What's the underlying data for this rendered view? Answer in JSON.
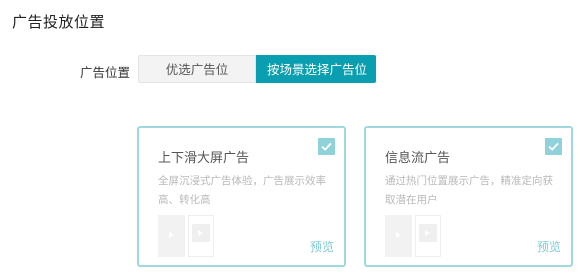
{
  "section": {
    "title": "广告投放位置"
  },
  "placement": {
    "label": "广告位置",
    "options": [
      "优选广告位",
      "按场景选择广告位"
    ],
    "selected": "按场景选择广告位"
  },
  "cards": [
    {
      "title": "上下滑大屏广告",
      "description": "全屏沉浸式广告体验，广告展示效率高、转化高",
      "checked": true,
      "preview_label": "预览"
    },
    {
      "title": "信息流广告",
      "description": "通过热门位置展示广告，精准定向获取潜在用户",
      "checked": true,
      "preview_label": "预览"
    }
  ],
  "colors": {
    "accent": "#0a9fb0",
    "card_border": "#9fd8df",
    "check": "#8fd2da"
  }
}
